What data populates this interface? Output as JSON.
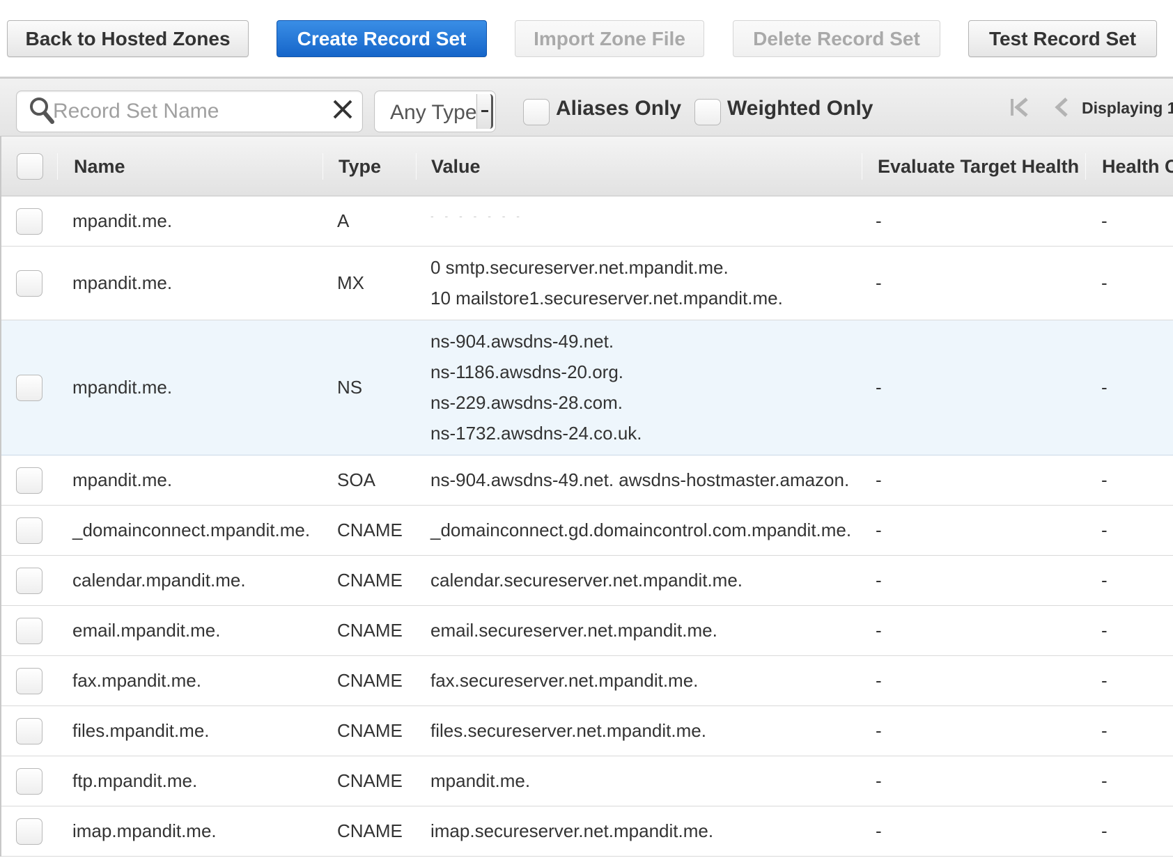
{
  "toolbar": {
    "back": "Back to Hosted Zones",
    "create": "Create Record Set",
    "import": "Import Zone File",
    "delete": "Delete Record Set",
    "test": "Test Record Set"
  },
  "filters": {
    "search_placeholder": "Record Set Name",
    "type_selected": "Any Type",
    "aliases_only": "Aliases Only",
    "weighted_only": "Weighted Only",
    "pager_label": "Displaying 1"
  },
  "table": {
    "columns": {
      "name": "Name",
      "type": "Type",
      "value": "Value",
      "evaluate_target_health": "Evaluate Target Health",
      "health_check": "Health C"
    },
    "rows": [
      {
        "name": "mpandit.me.",
        "type": "A",
        "value": [
          "- - - - - - -"
        ],
        "eth": "-",
        "hc": "-"
      },
      {
        "name": "mpandit.me.",
        "type": "MX",
        "value": [
          "0 smtp.secureserver.net.mpandit.me.",
          "10 mailstore1.secureserver.net.mpandit.me."
        ],
        "eth": "-",
        "hc": "-"
      },
      {
        "name": "mpandit.me.",
        "type": "NS",
        "value": [
          "ns-904.awsdns-49.net.",
          "ns-1186.awsdns-20.org.",
          "ns-229.awsdns-28.com.",
          "ns-1732.awsdns-24.co.uk."
        ],
        "eth": "-",
        "hc": "-"
      },
      {
        "name": "mpandit.me.",
        "type": "SOA",
        "value": [
          "ns-904.awsdns-49.net. awsdns-hostmaster.amazon."
        ],
        "eth": "-",
        "hc": "-"
      },
      {
        "name": "_domainconnect.mpandit.me.",
        "type": "CNAME",
        "value": [
          "_domainconnect.gd.domaincontrol.com.mpandit.me."
        ],
        "eth": "-",
        "hc": "-"
      },
      {
        "name": "calendar.mpandit.me.",
        "type": "CNAME",
        "value": [
          "calendar.secureserver.net.mpandit.me."
        ],
        "eth": "-",
        "hc": "-"
      },
      {
        "name": "email.mpandit.me.",
        "type": "CNAME",
        "value": [
          "email.secureserver.net.mpandit.me."
        ],
        "eth": "-",
        "hc": "-"
      },
      {
        "name": "fax.mpandit.me.",
        "type": "CNAME",
        "value": [
          "fax.secureserver.net.mpandit.me."
        ],
        "eth": "-",
        "hc": "-"
      },
      {
        "name": "files.mpandit.me.",
        "type": "CNAME",
        "value": [
          "files.secureserver.net.mpandit.me."
        ],
        "eth": "-",
        "hc": "-"
      },
      {
        "name": "ftp.mpandit.me.",
        "type": "CNAME",
        "value": [
          "mpandit.me."
        ],
        "eth": "-",
        "hc": "-"
      },
      {
        "name": "imap.mpandit.me.",
        "type": "CNAME",
        "value": [
          "imap.secureserver.net.mpandit.me."
        ],
        "eth": "-",
        "hc": "-"
      }
    ]
  },
  "icons": {
    "search": "search-icon",
    "clear": "close-icon",
    "pager_first": "first-page-icon",
    "pager_prev": "previous-page-icon"
  },
  "colors": {
    "primary_button": "#1f73d3",
    "selected_row": "#eef6fc"
  }
}
